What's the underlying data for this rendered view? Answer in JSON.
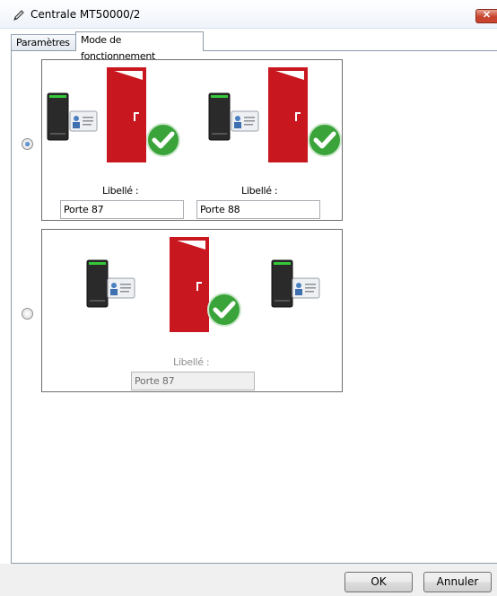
{
  "window": {
    "title": "Centrale MT50000/2",
    "close_glyph": "✕"
  },
  "tabs": [
    {
      "label": "Paramètres",
      "active": false
    },
    {
      "label": "Mode de fonctionnement",
      "active": true
    }
  ],
  "options": [
    {
      "selected": true,
      "doors": [
        {
          "label": "Libellé :",
          "value": "Porte 87"
        },
        {
          "label": "Libellé :",
          "value": "Porte 88"
        }
      ]
    },
    {
      "selected": false,
      "doors": [
        {
          "label": "Libellé :",
          "value": "Porte 87",
          "disabled": true
        }
      ]
    }
  ],
  "buttons": {
    "ok": "OK",
    "cancel": "Annuler"
  },
  "colors": {
    "door_red": "#c8171e",
    "check_green": "#3aa43a",
    "reader_dark": "#2a2a2a",
    "reader_led": "#35c83a"
  },
  "icons": [
    "pencil-icon",
    "close-icon",
    "card-reader-icon",
    "badge-card-icon",
    "door-open-icon",
    "checkmark-icon"
  ]
}
